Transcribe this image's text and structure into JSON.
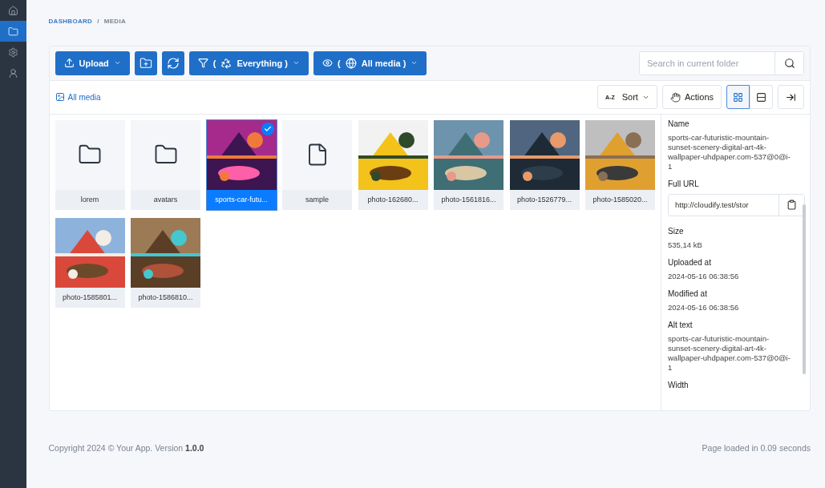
{
  "sidebar": {
    "items": [
      {
        "selected": false
      },
      {
        "selected": true
      },
      {
        "selected": false
      },
      {
        "selected": false
      }
    ]
  },
  "breadcrumb": [
    {
      "label": "DASHBOARD",
      "link": true
    },
    {
      "label": "/",
      "link": false
    },
    {
      "label": "MEDIA",
      "link": false
    }
  ],
  "toolbar": {
    "upload": {
      "label": "Upload"
    },
    "filter": {
      "open": "(",
      "label": "Everything )"
    },
    "visibility": {
      "open": "(",
      "label": "All media )"
    },
    "search": {
      "placeholder": "Search in current folder"
    }
  },
  "subbar": {
    "location": "All media",
    "sort": {
      "icon_text": "A-Z",
      "label": "Sort"
    },
    "actions": {
      "label": "Actions"
    },
    "views": [
      {
        "selected": true
      },
      {
        "selected": false
      }
    ]
  },
  "items": [
    {
      "kind": "folder",
      "label": "lorem",
      "selected": false
    },
    {
      "kind": "folder",
      "label": "avatars",
      "selected": false
    },
    {
      "kind": "picture",
      "label": "sports-car-futu...",
      "selected": true
    },
    {
      "kind": "file",
      "label": "sample",
      "selected": false
    },
    {
      "kind": "picture",
      "label": "photo-162680...",
      "selected": false
    },
    {
      "kind": "picture",
      "label": "photo-1561816...",
      "selected": false
    },
    {
      "kind": "picture",
      "label": "photo-1526779...",
      "selected": false
    },
    {
      "kind": "picture",
      "label": "photo-1585020...",
      "selected": false
    },
    {
      "kind": "picture",
      "label": "photo-1585801...",
      "selected": false
    },
    {
      "kind": "picture",
      "label": "photo-1586810...",
      "selected": false
    }
  ],
  "details": [
    {
      "kind": "text",
      "label": "Name",
      "value": "sports-car-futuristic-mountain-sunset-scenery-digital-art-4k-wallpaper-uhdpaper.com-537@0@i-1"
    },
    {
      "kind": "url",
      "label": "Full URL",
      "value": "http://cloudify.test/stor"
    },
    {
      "kind": "text",
      "label": "Size",
      "value": "535,14 kB"
    },
    {
      "kind": "text",
      "label": "Uploaded at",
      "value": "2024-05-16 06:38:56"
    },
    {
      "kind": "text",
      "label": "Modified at",
      "value": "2024-05-16 06:38:56"
    },
    {
      "kind": "text",
      "label": "Alt text",
      "value": "sports-car-futuristic-mountain-sunset-scenery-digital-art-4k-wallpaper-uhdpaper.com-537@0@i-1"
    },
    {
      "kind": "heading",
      "label": "Width"
    }
  ],
  "footer": {
    "copyright": "Copyright 2024 © Your App. Version **1.0.0**",
    "timing": "Page loaded in 0.09 seconds"
  }
}
